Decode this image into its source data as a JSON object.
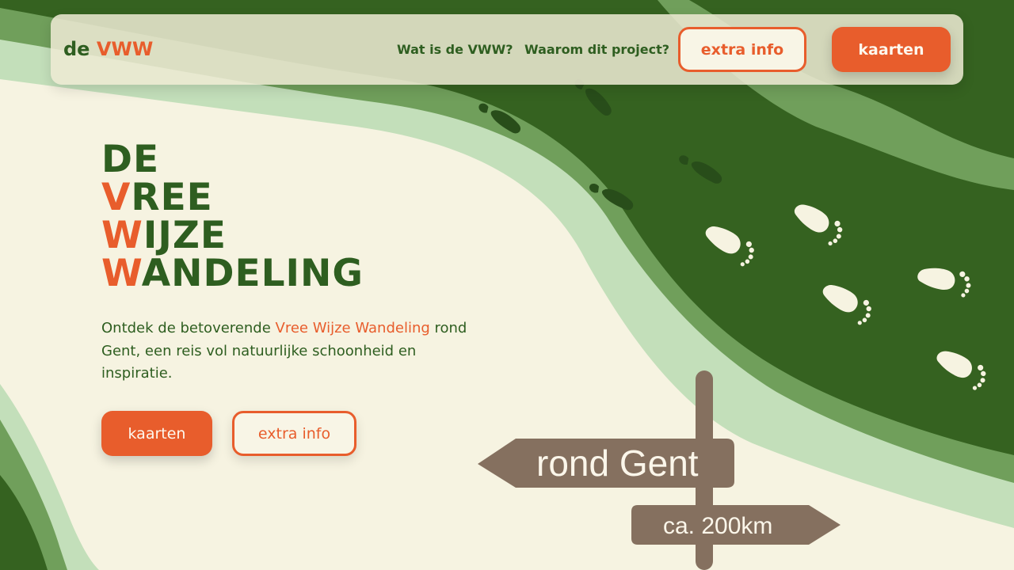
{
  "colors": {
    "background": "#f6f3e1",
    "brand_green": "#2e5e20",
    "dark_green": "#356220",
    "mid_green": "#709f5b",
    "light_green": "#c3dfba",
    "accent_orange": "#e85d2c",
    "sign_brown": "#85705f",
    "footprint_cream": "#f6f3e1"
  },
  "nav": {
    "logo_prefix": "de",
    "logo_accent": "VWW",
    "links": [
      "Wat is de VWW?",
      "Waarom dit project?"
    ],
    "extra_info_label": "extra info",
    "kaarten_label": "kaarten"
  },
  "hero": {
    "title_lines": [
      {
        "first": "",
        "rest": "DE"
      },
      {
        "first": "V",
        "rest": "REE"
      },
      {
        "first": "W",
        "rest": "IJZE"
      },
      {
        "first": "W",
        "rest": "ANDELING"
      }
    ],
    "desc_before": "Ontdek de betoverende ",
    "desc_highlight": "Vree Wijze Wandeling",
    "desc_after": " rond Gent, een reis vol natuurlijke schoonheid en inspiratie.",
    "kaarten_label": "kaarten",
    "extra_info_label": "extra info"
  },
  "sign": {
    "top_label": "rond Gent",
    "bottom_label": "ca. 200km"
  },
  "icons": {
    "footprint": "footprint-icon",
    "signpost": "signpost-icon"
  }
}
